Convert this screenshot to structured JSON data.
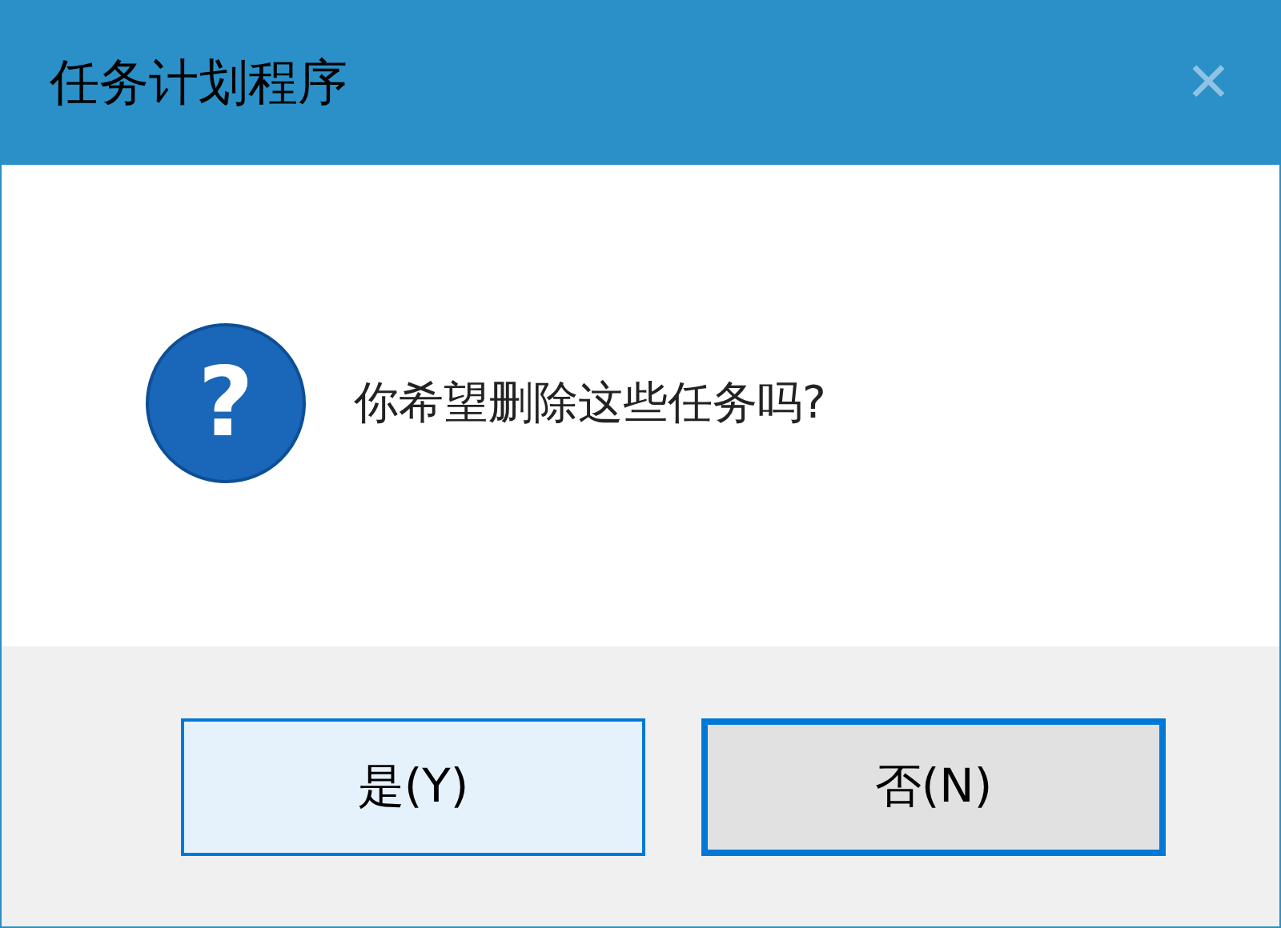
{
  "window": {
    "title": "任务计划程序",
    "close": "✕"
  },
  "message": {
    "icon": "?",
    "text": "你希望删除这些任务吗?"
  },
  "buttons": [
    {
      "label": "是(Y)",
      "hovered": true,
      "focused": false
    },
    {
      "label": "否(N)",
      "hovered": false,
      "focused": true
    }
  ]
}
